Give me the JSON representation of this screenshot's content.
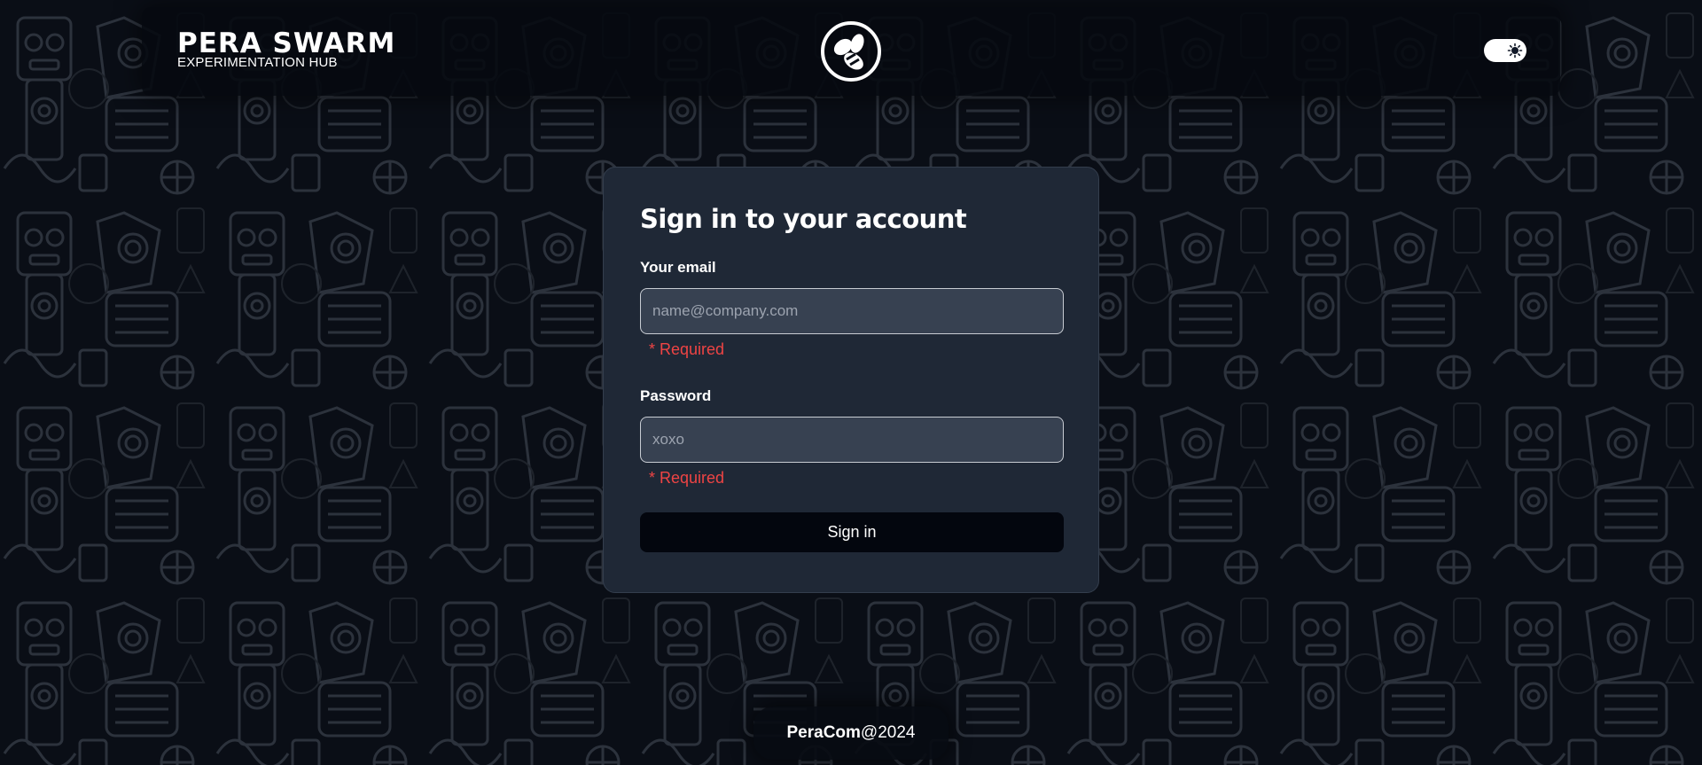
{
  "header": {
    "brand_title": "PERA SWARM",
    "brand_subtitle": "EXPERIMENTATION HUB",
    "center_logo_icon": "bee-icon",
    "theme_toggle_icon": "sun-icon"
  },
  "signin": {
    "title": "Sign in to your account",
    "email": {
      "label": "Your email",
      "placeholder": "name@company.com",
      "value": "",
      "error": "* Required"
    },
    "password": {
      "label": "Password",
      "placeholder": "xoxo",
      "value": "",
      "error": "* Required"
    },
    "submit_label": "Sign in"
  },
  "footer": {
    "brand": "PeraCom",
    "suffix": "@2024"
  },
  "colors": {
    "background": "#080c14",
    "card": "#1f2836",
    "input": "#374151",
    "error": "#ef4444",
    "button": "#03060e"
  }
}
